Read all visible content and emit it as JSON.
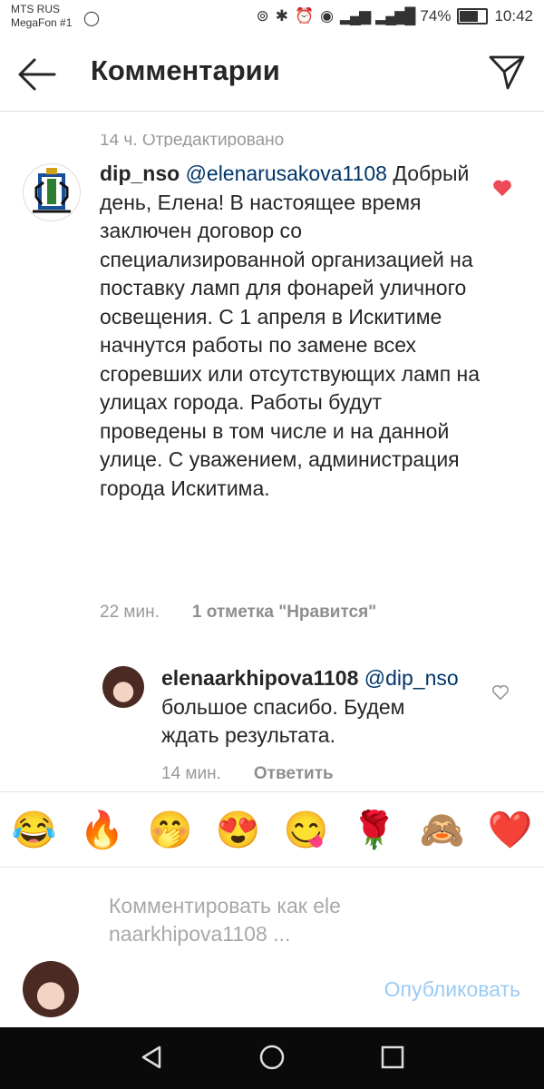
{
  "status_bar": {
    "carrier_line1": "MTS RUS",
    "carrier_line2": "MegaFon #1",
    "battery": "74%",
    "time": "10:42"
  },
  "header": {
    "title": "Комментарии",
    "back_icon": "arrow-left-icon",
    "send_icon": "paper-plane-icon"
  },
  "scrolled_prev": {
    "text": "14 ч.   Отредактировано"
  },
  "comments": [
    {
      "username": "dip_nso",
      "mention": "@elenarusakova1108",
      "text": "Добрый день, Елена! В настоящее время заключен договор со специализированной организацией на поставку ламп для фонарей уличного освещения. С 1 апреля в Искитиме начнутся работы по замене всех сгоревших или отсутствующих ламп на улицах города. Работы будут проведены в том числе и на данной улице. С уважением, администрация города Искитима.",
      "time": "22 мин.",
      "likes_label": "1 отметка \"Нравится\"",
      "liked": true,
      "heart_color": "#ed4956"
    },
    {
      "username": "elenaarkhipova1108",
      "mention": "@dip_nso",
      "text": "большое спасибо. Будем ждать результата.",
      "time": "14 мин.",
      "reply_label": "Ответить",
      "liked": false
    }
  ],
  "emoji_bar": [
    "😂",
    "🔥",
    "🤭",
    "😍",
    "😋",
    "🌹",
    "🙈",
    "❤️"
  ],
  "composer": {
    "placeholder": "Комментировать как elenaarkhipova1108 ...",
    "publish_label": "Опубликовать",
    "publish_color": "#9ccbf5"
  },
  "nav_bar": {
    "icons": [
      "back-triangle-icon",
      "home-circle-icon",
      "recents-square-icon"
    ]
  }
}
